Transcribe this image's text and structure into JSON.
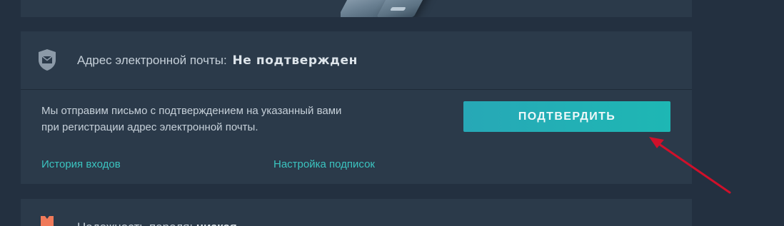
{
  "email_section": {
    "label": "Адрес электронной почты:",
    "status": "Не подтвержден",
    "description_line1": "Мы отправим письмо с подтверждением на указанный вами",
    "description_line2": "при регистрации адрес электронной почты.",
    "confirm_button": "ПОДТВЕРДИТЬ",
    "icon": "mail-shield-icon"
  },
  "links": {
    "login_history": "История входов",
    "subscription_settings": "Настройка подписок"
  },
  "next_section": {
    "label_start": "Надежность пароля:",
    "label_strength": "низкая",
    "icon": "shield-warning-icon"
  },
  "colors": {
    "background": "#233040",
    "card": "#2b3a4a",
    "accent": "#27a8b6",
    "link": "#3bc4c0",
    "annotation_arrow": "#d0102a",
    "warning_icon": "#f07a5a"
  }
}
